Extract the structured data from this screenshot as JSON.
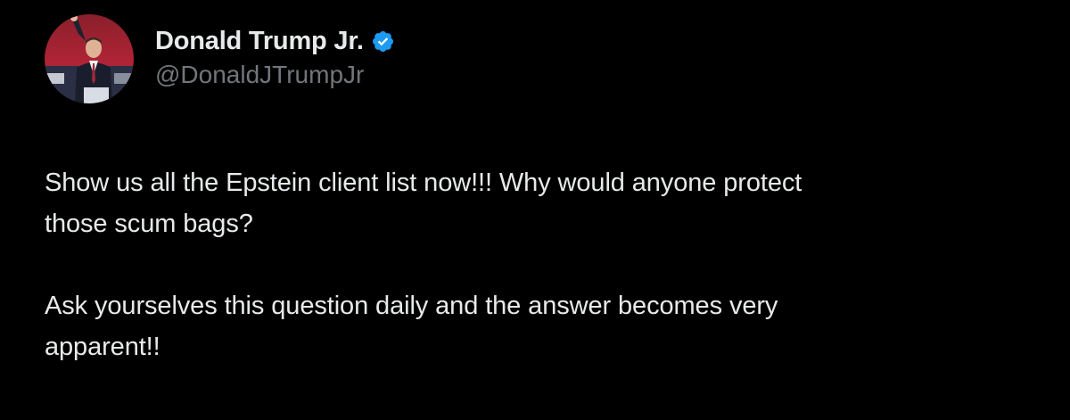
{
  "author": {
    "display_name": "Donald Trump Jr.",
    "handle": "@DonaldJTrumpJr",
    "verified": true,
    "verified_color": "#1d9bf0",
    "avatar_icon": "profile-photo"
  },
  "post": {
    "paragraphs": [
      "Show us all the Epstein client list now!!! Why would anyone protect\nthose scum bags?",
      "Ask yourselves this question daily and the answer becomes very\napparent!!"
    ]
  },
  "theme": {
    "background": "#000000",
    "text": "#e7e9ea",
    "secondary_text": "#71767b"
  }
}
